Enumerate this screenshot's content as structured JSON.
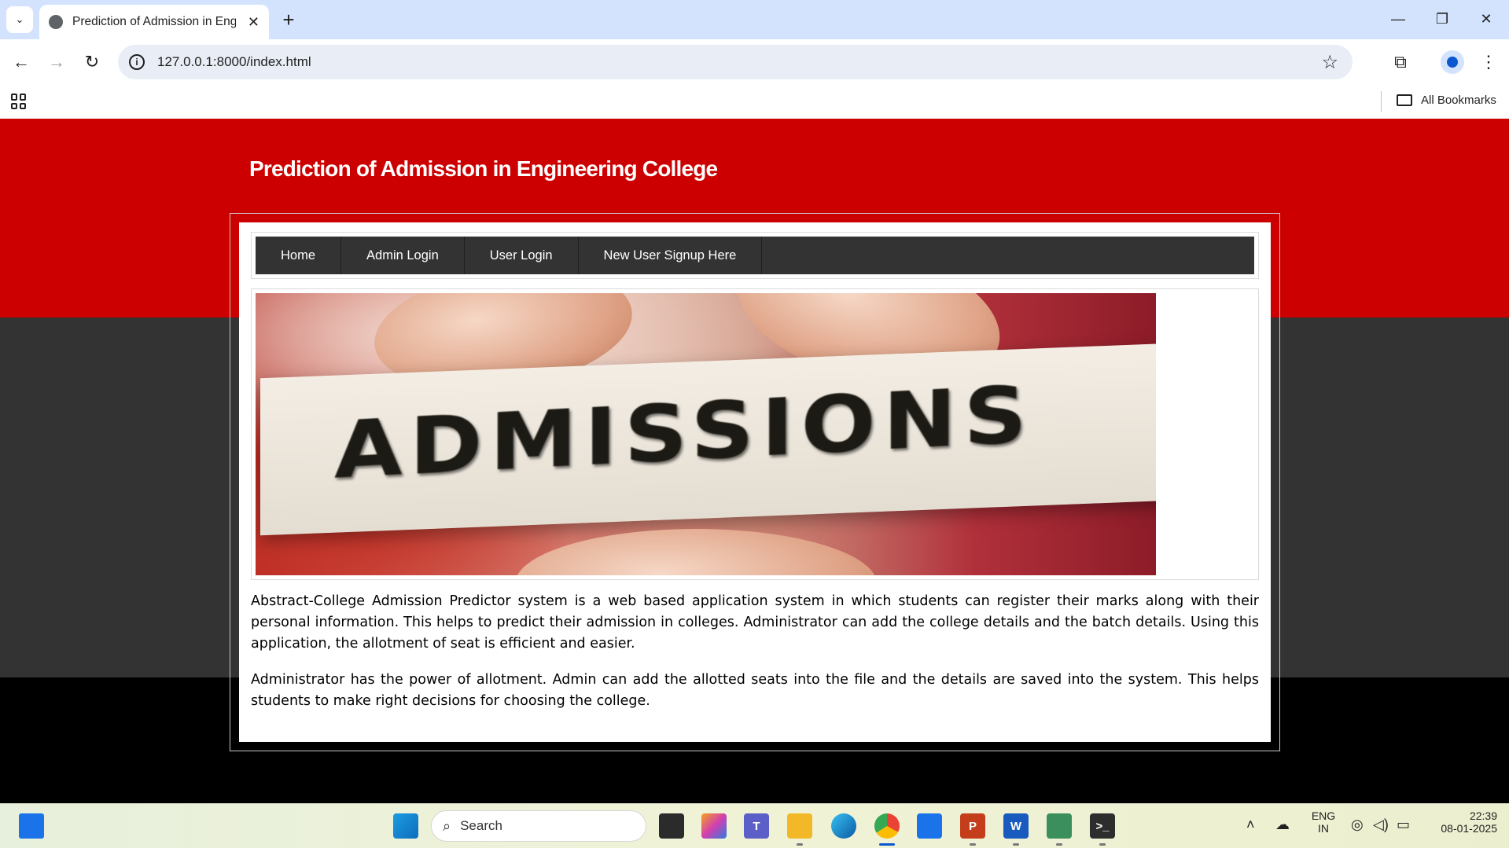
{
  "browser": {
    "tab_title": "Prediction of Admission in Engineering College",
    "new_tab_symbol": "+",
    "tab_close_symbol": "✕",
    "url": "127.0.0.1:8000/index.html",
    "bookmarks_label": "All Bookmarks",
    "icons": [
      "tab-search-icon",
      "globe-favicon-icon",
      "close-icon",
      "new-tab-icon",
      "minimize-icon",
      "restore-icon",
      "close-window-icon",
      "back-icon",
      "forward-icon",
      "reload-icon",
      "site-info-icon",
      "star-icon",
      "extensions-icon",
      "profile-icon",
      "menu-icon",
      "apps-icon",
      "folder-icon"
    ]
  },
  "site": {
    "title": "Prediction of Admission in Engineering College",
    "nav": [
      {
        "label": "Home"
      },
      {
        "label": "Admin Login"
      },
      {
        "label": "User Login"
      },
      {
        "label": "New User Signup Here"
      }
    ],
    "banner_text": "ADMISSIONS",
    "paragraphs": [
      "Abstract-College Admission Predictor system is a web based application system in which students can register their marks along with their personal information. This helps to predict their admission in colleges. Administrator can add the college details and the batch details. Using this application, the allotment of seat is efficient and easier.",
      "Administrator has the power of allotment. Admin can add the allotted seats into the file and the details are saved into the system. This helps students to make right decisions for choosing the college."
    ],
    "colors": {
      "header_red": "#cc0000",
      "menu_dark": "#333333",
      "band_dark": "#333333",
      "band_black": "#000000"
    }
  },
  "taskbar": {
    "search_placeholder": "Search",
    "language_line1": "ENG",
    "language_line2": "IN",
    "time": "22:39",
    "date": "08-01-2025",
    "apps": [
      "start-icon",
      "task-view-icon",
      "copilot-icon",
      "teams-icon",
      "file-explorer-icon",
      "edge-icon",
      "chrome-icon",
      "store-icon",
      "powerpoint-icon",
      "word-icon",
      "app-icon",
      "terminal-icon"
    ]
  }
}
